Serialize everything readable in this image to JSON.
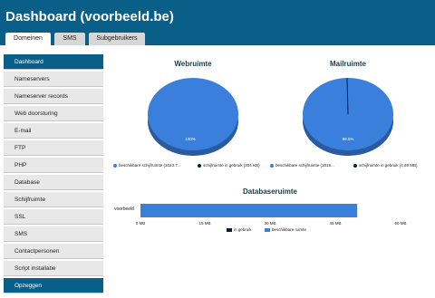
{
  "header": {
    "title": "Dashboard (voorbeeld.be)",
    "tabs": [
      "Domeinen",
      "SMS",
      "Subgebruikers"
    ]
  },
  "sidebar": {
    "items": [
      "Dashboard",
      "Nameservers",
      "Nameserver records",
      "Web doorsturing",
      "E-mail",
      "FTP",
      "PHP",
      "Database",
      "Schijfruimte",
      "SSL",
      "SMS",
      "Contactpersonen",
      "Script installatie",
      "Opzeggen"
    ]
  },
  "colors": {
    "primary": "#0a5f88",
    "free_space": "#3a7fdc",
    "used_space": "#0f1d2d",
    "pie_side": "#2a5ba1"
  },
  "chart_data": [
    {
      "type": "pie",
      "title": "Webruimte",
      "slices": [
        {
          "label": "beschikbare schijfruimte (1023.7...",
          "value": 100
        },
        {
          "label": "schijfruimte in gebruik (304 KB)",
          "value": 0
        }
      ],
      "slice_label": "100%"
    },
    {
      "type": "pie",
      "title": "Mailruimte",
      "slices": [
        {
          "label": "beschikbare schijfruimte (1019...",
          "value": 99.5
        },
        {
          "label": "schijfruimte in gebruik (4.69 MB)",
          "value": 0.5
        }
      ],
      "slice_label": "99.5%"
    },
    {
      "type": "bar",
      "title": "Databaseruimte",
      "categories": [
        "voorbeeld"
      ],
      "series": [
        {
          "name": "in gebruik",
          "values": [
            0
          ]
        },
        {
          "name": "beschikbare ruimte",
          "values": [
            50
          ]
        }
      ],
      "xlim": [
        0,
        60
      ],
      "xticks": [
        "0 MB",
        "15 MB",
        "30 MB",
        "45 MB",
        "60 MB"
      ]
    }
  ]
}
